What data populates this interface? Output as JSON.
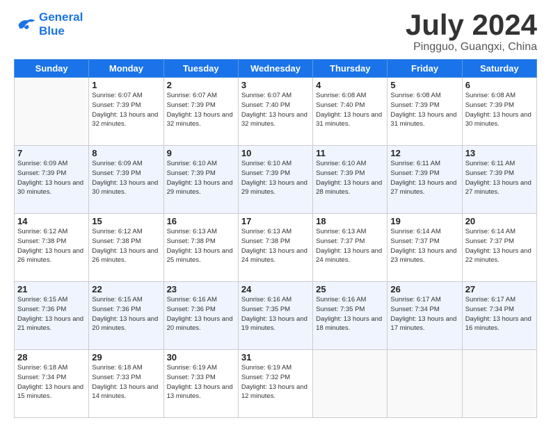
{
  "logo": {
    "line1": "General",
    "line2": "Blue"
  },
  "title": "July 2024",
  "location": "Pingguo, Guangxi, China",
  "days_of_week": [
    "Sunday",
    "Monday",
    "Tuesday",
    "Wednesday",
    "Thursday",
    "Friday",
    "Saturday"
  ],
  "weeks": [
    [
      {
        "day": "",
        "sunrise": "",
        "sunset": "",
        "daylight": ""
      },
      {
        "day": "1",
        "sunrise": "6:07 AM",
        "sunset": "7:39 PM",
        "daylight": "13 hours and 32 minutes."
      },
      {
        "day": "2",
        "sunrise": "6:07 AM",
        "sunset": "7:39 PM",
        "daylight": "13 hours and 32 minutes."
      },
      {
        "day": "3",
        "sunrise": "6:07 AM",
        "sunset": "7:40 PM",
        "daylight": "13 hours and 32 minutes."
      },
      {
        "day": "4",
        "sunrise": "6:08 AM",
        "sunset": "7:40 PM",
        "daylight": "13 hours and 31 minutes."
      },
      {
        "day": "5",
        "sunrise": "6:08 AM",
        "sunset": "7:39 PM",
        "daylight": "13 hours and 31 minutes."
      },
      {
        "day": "6",
        "sunrise": "6:08 AM",
        "sunset": "7:39 PM",
        "daylight": "13 hours and 30 minutes."
      }
    ],
    [
      {
        "day": "7",
        "sunrise": "6:09 AM",
        "sunset": "7:39 PM",
        "daylight": "13 hours and 30 minutes."
      },
      {
        "day": "8",
        "sunrise": "6:09 AM",
        "sunset": "7:39 PM",
        "daylight": "13 hours and 30 minutes."
      },
      {
        "day": "9",
        "sunrise": "6:10 AM",
        "sunset": "7:39 PM",
        "daylight": "13 hours and 29 minutes."
      },
      {
        "day": "10",
        "sunrise": "6:10 AM",
        "sunset": "7:39 PM",
        "daylight": "13 hours and 29 minutes."
      },
      {
        "day": "11",
        "sunrise": "6:10 AM",
        "sunset": "7:39 PM",
        "daylight": "13 hours and 28 minutes."
      },
      {
        "day": "12",
        "sunrise": "6:11 AM",
        "sunset": "7:39 PM",
        "daylight": "13 hours and 27 minutes."
      },
      {
        "day": "13",
        "sunrise": "6:11 AM",
        "sunset": "7:39 PM",
        "daylight": "13 hours and 27 minutes."
      }
    ],
    [
      {
        "day": "14",
        "sunrise": "6:12 AM",
        "sunset": "7:38 PM",
        "daylight": "13 hours and 26 minutes."
      },
      {
        "day": "15",
        "sunrise": "6:12 AM",
        "sunset": "7:38 PM",
        "daylight": "13 hours and 26 minutes."
      },
      {
        "day": "16",
        "sunrise": "6:13 AM",
        "sunset": "7:38 PM",
        "daylight": "13 hours and 25 minutes."
      },
      {
        "day": "17",
        "sunrise": "6:13 AM",
        "sunset": "7:38 PM",
        "daylight": "13 hours and 24 minutes."
      },
      {
        "day": "18",
        "sunrise": "6:13 AM",
        "sunset": "7:37 PM",
        "daylight": "13 hours and 24 minutes."
      },
      {
        "day": "19",
        "sunrise": "6:14 AM",
        "sunset": "7:37 PM",
        "daylight": "13 hours and 23 minutes."
      },
      {
        "day": "20",
        "sunrise": "6:14 AM",
        "sunset": "7:37 PM",
        "daylight": "13 hours and 22 minutes."
      }
    ],
    [
      {
        "day": "21",
        "sunrise": "6:15 AM",
        "sunset": "7:36 PM",
        "daylight": "13 hours and 21 minutes."
      },
      {
        "day": "22",
        "sunrise": "6:15 AM",
        "sunset": "7:36 PM",
        "daylight": "13 hours and 20 minutes."
      },
      {
        "day": "23",
        "sunrise": "6:16 AM",
        "sunset": "7:36 PM",
        "daylight": "13 hours and 20 minutes."
      },
      {
        "day": "24",
        "sunrise": "6:16 AM",
        "sunset": "7:35 PM",
        "daylight": "13 hours and 19 minutes."
      },
      {
        "day": "25",
        "sunrise": "6:16 AM",
        "sunset": "7:35 PM",
        "daylight": "13 hours and 18 minutes."
      },
      {
        "day": "26",
        "sunrise": "6:17 AM",
        "sunset": "7:34 PM",
        "daylight": "13 hours and 17 minutes."
      },
      {
        "day": "27",
        "sunrise": "6:17 AM",
        "sunset": "7:34 PM",
        "daylight": "13 hours and 16 minutes."
      }
    ],
    [
      {
        "day": "28",
        "sunrise": "6:18 AM",
        "sunset": "7:34 PM",
        "daylight": "13 hours and 15 minutes."
      },
      {
        "day": "29",
        "sunrise": "6:18 AM",
        "sunset": "7:33 PM",
        "daylight": "13 hours and 14 minutes."
      },
      {
        "day": "30",
        "sunrise": "6:19 AM",
        "sunset": "7:33 PM",
        "daylight": "13 hours and 13 minutes."
      },
      {
        "day": "31",
        "sunrise": "6:19 AM",
        "sunset": "7:32 PM",
        "daylight": "13 hours and 12 minutes."
      },
      {
        "day": "",
        "sunrise": "",
        "sunset": "",
        "daylight": ""
      },
      {
        "day": "",
        "sunrise": "",
        "sunset": "",
        "daylight": ""
      },
      {
        "day": "",
        "sunrise": "",
        "sunset": "",
        "daylight": ""
      }
    ]
  ],
  "labels": {
    "sunrise_prefix": "Sunrise: ",
    "sunset_prefix": "Sunset: ",
    "daylight_prefix": "Daylight: "
  }
}
